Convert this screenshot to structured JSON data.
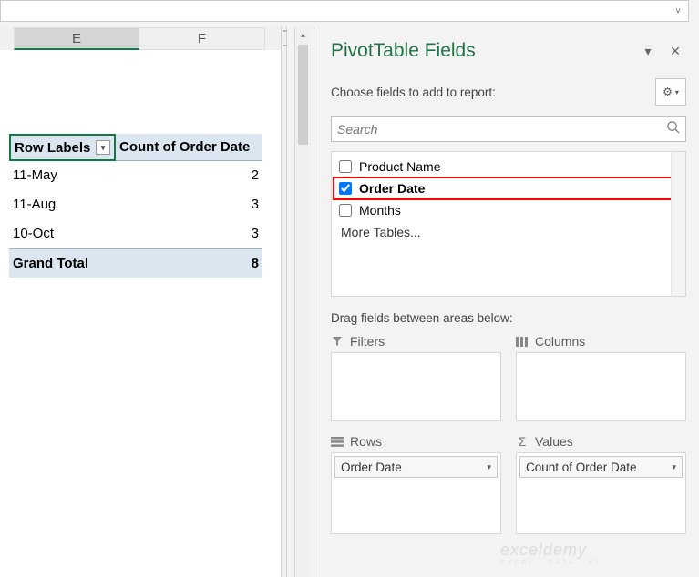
{
  "formula_bar": {
    "expand_glyph": "˅"
  },
  "columns": [
    "E",
    "F"
  ],
  "pivot": {
    "row_labels_header": "Row Labels",
    "count_header": "Count of Order Date",
    "rows": [
      {
        "label": "11-May",
        "value": "2"
      },
      {
        "label": "11-Aug",
        "value": "3"
      },
      {
        "label": "10-Oct",
        "value": "3"
      }
    ],
    "total_label": "Grand Total",
    "total_value": "8"
  },
  "pane": {
    "title": "PivotTable Fields",
    "choose_label": "Choose fields to add to report:",
    "search_placeholder": "Search",
    "fields": {
      "product_name": "Product Name",
      "order_date": "Order Date",
      "months": "Months",
      "more": "More Tables..."
    },
    "drag_label": "Drag fields between areas below:",
    "areas": {
      "filters": "Filters",
      "columns": "Columns",
      "rows": "Rows",
      "values": "Values"
    },
    "pills": {
      "rows": "Order Date",
      "values": "Count of Order Date"
    }
  },
  "watermark": {
    "brand": "exceldemy",
    "tag": "EXCEL · DATA · BI"
  }
}
